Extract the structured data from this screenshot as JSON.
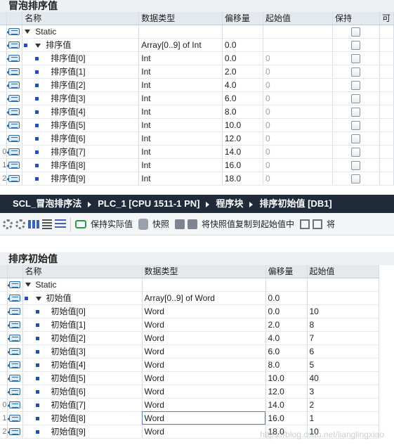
{
  "top": {
    "title": "冒泡排序值",
    "headers": [
      "名称",
      "数据类型",
      "偏移量",
      "起始值",
      "保持",
      "可"
    ],
    "static_label": "Static",
    "array_row": {
      "name": "排序值",
      "type": "Array[0..9] of Int",
      "offset": "0.0"
    },
    "rows": [
      {
        "num": "",
        "name": "排序值[0]",
        "type": "Int",
        "offset": "0.0",
        "start": "0"
      },
      {
        "num": "",
        "name": "排序值[1]",
        "type": "Int",
        "offset": "2.0",
        "start": "0"
      },
      {
        "num": "",
        "name": "排序值[2]",
        "type": "Int",
        "offset": "4.0",
        "start": "0"
      },
      {
        "num": "",
        "name": "排序值[3]",
        "type": "Int",
        "offset": "6.0",
        "start": "0"
      },
      {
        "num": "",
        "name": "排序值[4]",
        "type": "Int",
        "offset": "8.0",
        "start": "0"
      },
      {
        "num": "",
        "name": "排序值[5]",
        "type": "Int",
        "offset": "10.0",
        "start": "0"
      },
      {
        "num": "",
        "name": "排序值[6]",
        "type": "Int",
        "offset": "12.0",
        "start": "0"
      },
      {
        "num": "0",
        "name": "排序值[7]",
        "type": "Int",
        "offset": "14.0",
        "start": "0"
      },
      {
        "num": "1",
        "name": "排序值[8]",
        "type": "Int",
        "offset": "16.0",
        "start": "0"
      },
      {
        "num": "2",
        "name": "排序值[9]",
        "type": "Int",
        "offset": "18.0",
        "start": "0"
      }
    ]
  },
  "breadcrumb": [
    "SCL_冒泡排序法",
    "PLC_1 [CPU 1511-1 PN]",
    "程序块",
    "排序初始值 [DB1]"
  ],
  "toolbar": {
    "keep_actual": "保持实际值",
    "snapshot": "快照",
    "copy_snapshot": "将快照值复制到起始值中",
    "cut_label": "将"
  },
  "bottom": {
    "title": "排序初始值",
    "headers": [
      "名称",
      "数据类型",
      "偏移量",
      "起始值"
    ],
    "static_label": "Static",
    "array_row": {
      "name": "初始值",
      "type": "Array[0..9] of Word",
      "offset": "0.0"
    },
    "rows": [
      {
        "num": "",
        "name": "初始值[0]",
        "type": "Word",
        "offset": "0.0",
        "start": "10"
      },
      {
        "num": "",
        "name": "初始值[1]",
        "type": "Word",
        "offset": "2.0",
        "start": "8"
      },
      {
        "num": "",
        "name": "初始值[2]",
        "type": "Word",
        "offset": "4.0",
        "start": "7"
      },
      {
        "num": "",
        "name": "初始值[3]",
        "type": "Word",
        "offset": "6.0",
        "start": "6"
      },
      {
        "num": "",
        "name": "初始值[4]",
        "type": "Word",
        "offset": "8.0",
        "start": "5"
      },
      {
        "num": "",
        "name": "初始值[5]",
        "type": "Word",
        "offset": "10.0",
        "start": "40"
      },
      {
        "num": "",
        "name": "初始值[6]",
        "type": "Word",
        "offset": "12.0",
        "start": "3"
      },
      {
        "num": "0",
        "name": "初始值[7]",
        "type": "Word",
        "offset": "14.0",
        "start": "2"
      },
      {
        "num": "1",
        "name": "初始值[8]",
        "type": "Word",
        "offset": "16.0",
        "start": "1"
      },
      {
        "num": "2",
        "name": "初始值[9]",
        "type": "Word",
        "offset": "18.0",
        "start": "10"
      }
    ]
  },
  "watermark": "https://blog.csdn.net/lianglingxiao"
}
